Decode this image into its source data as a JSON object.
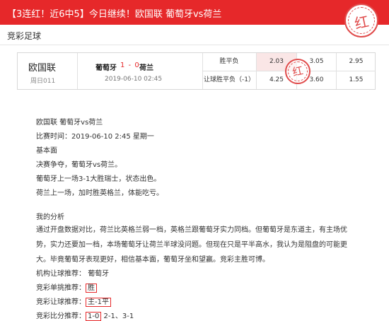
{
  "banner": {
    "text": "【3连红！近6中5】今日继续！欧国联 葡萄牙vs荷兰",
    "stamp": "红"
  },
  "section_title": "竞彩足球",
  "match": {
    "league": "欧国联",
    "weekday_code": "周日011",
    "home_team": "葡萄牙",
    "score": "1 - 0",
    "away_team": "荷兰",
    "datetime": "2019-06-10 02:45",
    "stamp": "红",
    "odds": [
      {
        "label": "胜平负",
        "values": [
          "2.03",
          "3.05",
          "2.95"
        ]
      },
      {
        "label": "让球胜平负（-1）",
        "values": [
          "4.25",
          "3.60",
          "1.55"
        ]
      }
    ]
  },
  "article": {
    "line1": "欧国联 葡萄牙vs荷兰",
    "line2": "比赛时间：2019-06-10 2:45 星期一",
    "line3": "基本面",
    "line4": "决赛争夺，葡萄牙vs荷兰。",
    "line5": "葡萄牙上一场3-1大胜瑞士，状态出色。",
    "line6": "荷兰上一场，加时胜英格兰，体能吃亏。",
    "analysis_title": "我的分析",
    "analysis_text": "通过开盘数据对比，荷兰比英格兰弱一档，英格兰跟葡萄牙实力同档。但葡萄牙是东道主，有主场优势，实力还要加一档，本场葡萄牙让荷兰半球没问题。但现在只是平半高水，我认为是阻盘的可能更大。毕竟葡萄牙表现更好，相信基本面，葡萄牙坐和望赢。竞彩主胜可博。",
    "rec_org_label": "机构让球推荐：",
    "rec_org_value": "葡萄牙",
    "rec_single_label": "竞彩单挑推荐：",
    "rec_single_value": "胜",
    "rec_handicap_label": "竞彩让球推荐：",
    "rec_handicap_value": "主-1平",
    "rec_score_label": "竞彩比分推荐：",
    "rec_score_value": "1-0",
    "rec_score_rest": "2-1、3-1"
  }
}
